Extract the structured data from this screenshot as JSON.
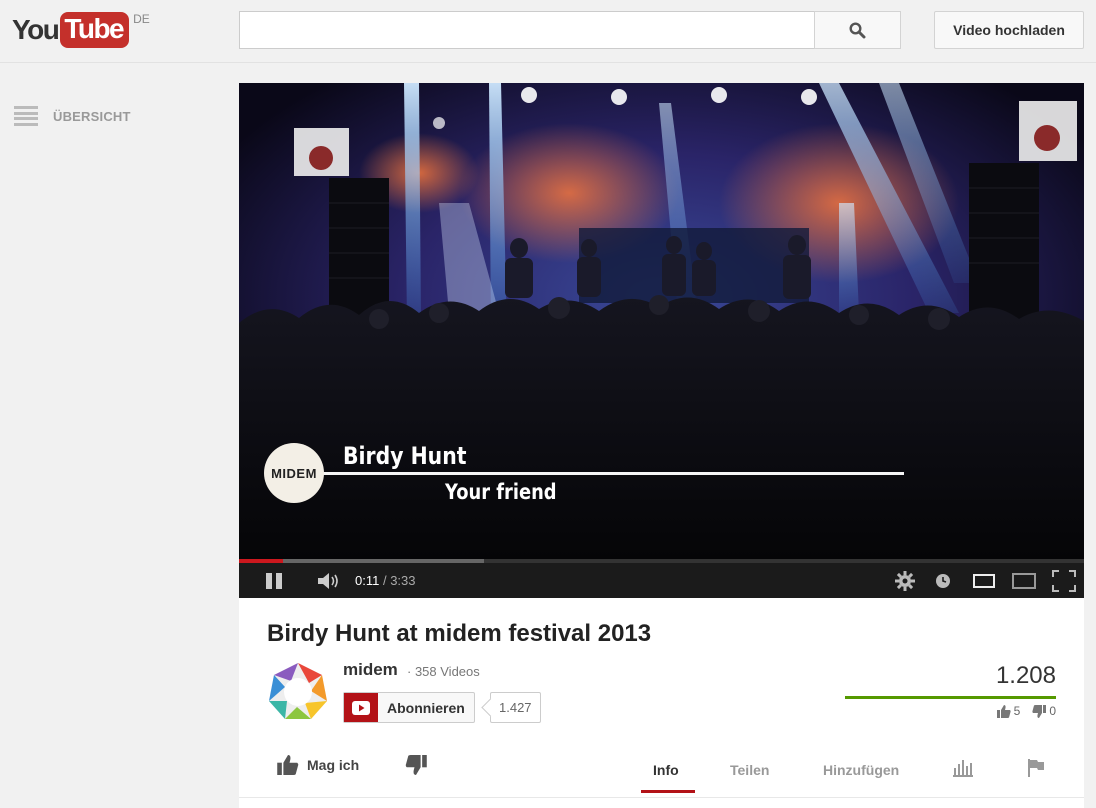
{
  "header": {
    "logo_you": "You",
    "logo_tube": "Tube",
    "logo_country": "DE",
    "search_placeholder": "",
    "search_icon": "search-icon",
    "upload_label": "Video hochladen"
  },
  "sidebar": {
    "guide_label": "ÜBERSICHT",
    "guide_icon": "menu-icon"
  },
  "player": {
    "lower_third": {
      "logo_text": "MIDEM",
      "artist": "Birdy Hunt",
      "song": "Your friend"
    },
    "current_time": "0:11",
    "separator": " / ",
    "total_time": "3:33",
    "played_fraction": 0.052,
    "loaded_fraction": 0.29,
    "colors": {
      "progress_played": "#cc181e",
      "controls_bg": "#1b1b1b"
    }
  },
  "video": {
    "title": "Birdy Hunt at midem festival 2013",
    "channel_name": "midem",
    "video_count": "· 358 Videos",
    "subscribe_label": "Abonnieren",
    "subscriber_count": "1.427",
    "views": "1.208",
    "likes": "5",
    "dislikes": "0",
    "like_fraction": 1.0
  },
  "actions": {
    "like_label": "Mag ich",
    "tabs": [
      {
        "label": "Info",
        "active": true
      },
      {
        "label": "Teilen",
        "active": false
      },
      {
        "label": "Hinzufügen",
        "active": false
      }
    ]
  }
}
